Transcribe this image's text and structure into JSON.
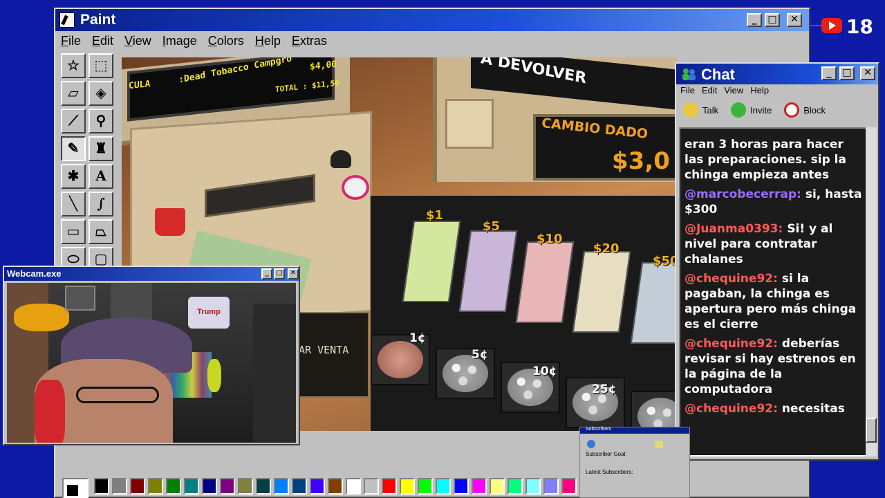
{
  "paint": {
    "title": "Paint",
    "menu": [
      "File",
      "Edit",
      "View",
      "Image",
      "Colors",
      "Help",
      "Extras"
    ],
    "tools": [
      "free-select",
      "rect-select",
      "eraser",
      "fill",
      "eyedropper",
      "magnifier",
      "pencil",
      "brush",
      "airbrush",
      "text",
      "line",
      "curve",
      "rectangle",
      "polygon",
      "ellipse",
      "rounded-rectangle"
    ],
    "text_tool_glyph": "A",
    "palette": [
      "#000000",
      "#808080",
      "#800000",
      "#808000",
      "#008000",
      "#008080",
      "#000080",
      "#800080",
      "#808040",
      "#004040",
      "#0080ff",
      "#004080",
      "#4000ff",
      "#804000",
      "#ffffff",
      "#c0c0c0",
      "#ff0000",
      "#ffff00",
      "#00ff00",
      "#00ffff",
      "#0000ff",
      "#ff00ff",
      "#ffff80",
      "#00ff80",
      "#80ffff",
      "#8080ff",
      "#ff0080",
      "#ff8040"
    ]
  },
  "game": {
    "screen_item": ":Dead Tobacco Campgro",
    "screen_prefix": "CULA",
    "screen_price": "$4,00",
    "screen_total": "TOTAL : $11,50",
    "return_label": "A DEVOLVER",
    "change_label": "CAMBIO DADO",
    "change_amount": "$3,0",
    "sale_button": "AR VENTA",
    "bill_labels": [
      "$1",
      "$5",
      "$10",
      "$20",
      "$50"
    ],
    "coin_labels": [
      "1¢",
      "5¢",
      "10¢",
      "25¢"
    ]
  },
  "webcam": {
    "title": "Webcam.exe",
    "shelf_label": "Trump"
  },
  "chat": {
    "title": "Chat",
    "menu": [
      "File",
      "Edit",
      "View",
      "Help"
    ],
    "actions": [
      "Talk",
      "Invite",
      "Block"
    ],
    "messages": [
      {
        "user": "",
        "text": "eran 3 horas para hacer las preparaciones. sip la chinga empieza antes",
        "color": "#ffffff"
      },
      {
        "user": "@marcobecerrap:",
        "text": "si, hasta $300",
        "color": "#9b6cff"
      },
      {
        "user": "@Juanma0393:",
        "text": "Si! y al nivel para contratar chalanes",
        "color": "#ff5a5a"
      },
      {
        "user": "@chequine92:",
        "text": "si la pagaban, la chinga es apertura pero más chinga es el cierre",
        "color": "#ff5a5a"
      },
      {
        "user": "@chequine92:",
        "text": "deberías revisar si hay estrenos en la página de la computadora",
        "color": "#ff5a5a"
      },
      {
        "user": "@chequine92:",
        "text": "necesitas",
        "color": "#ff5a5a"
      }
    ]
  },
  "subscribers": {
    "title": "Subscribers",
    "goal_label": "Subscriber Goal:",
    "latest_label": "Latest Subscribers:"
  },
  "youtube": {
    "count": "18"
  }
}
